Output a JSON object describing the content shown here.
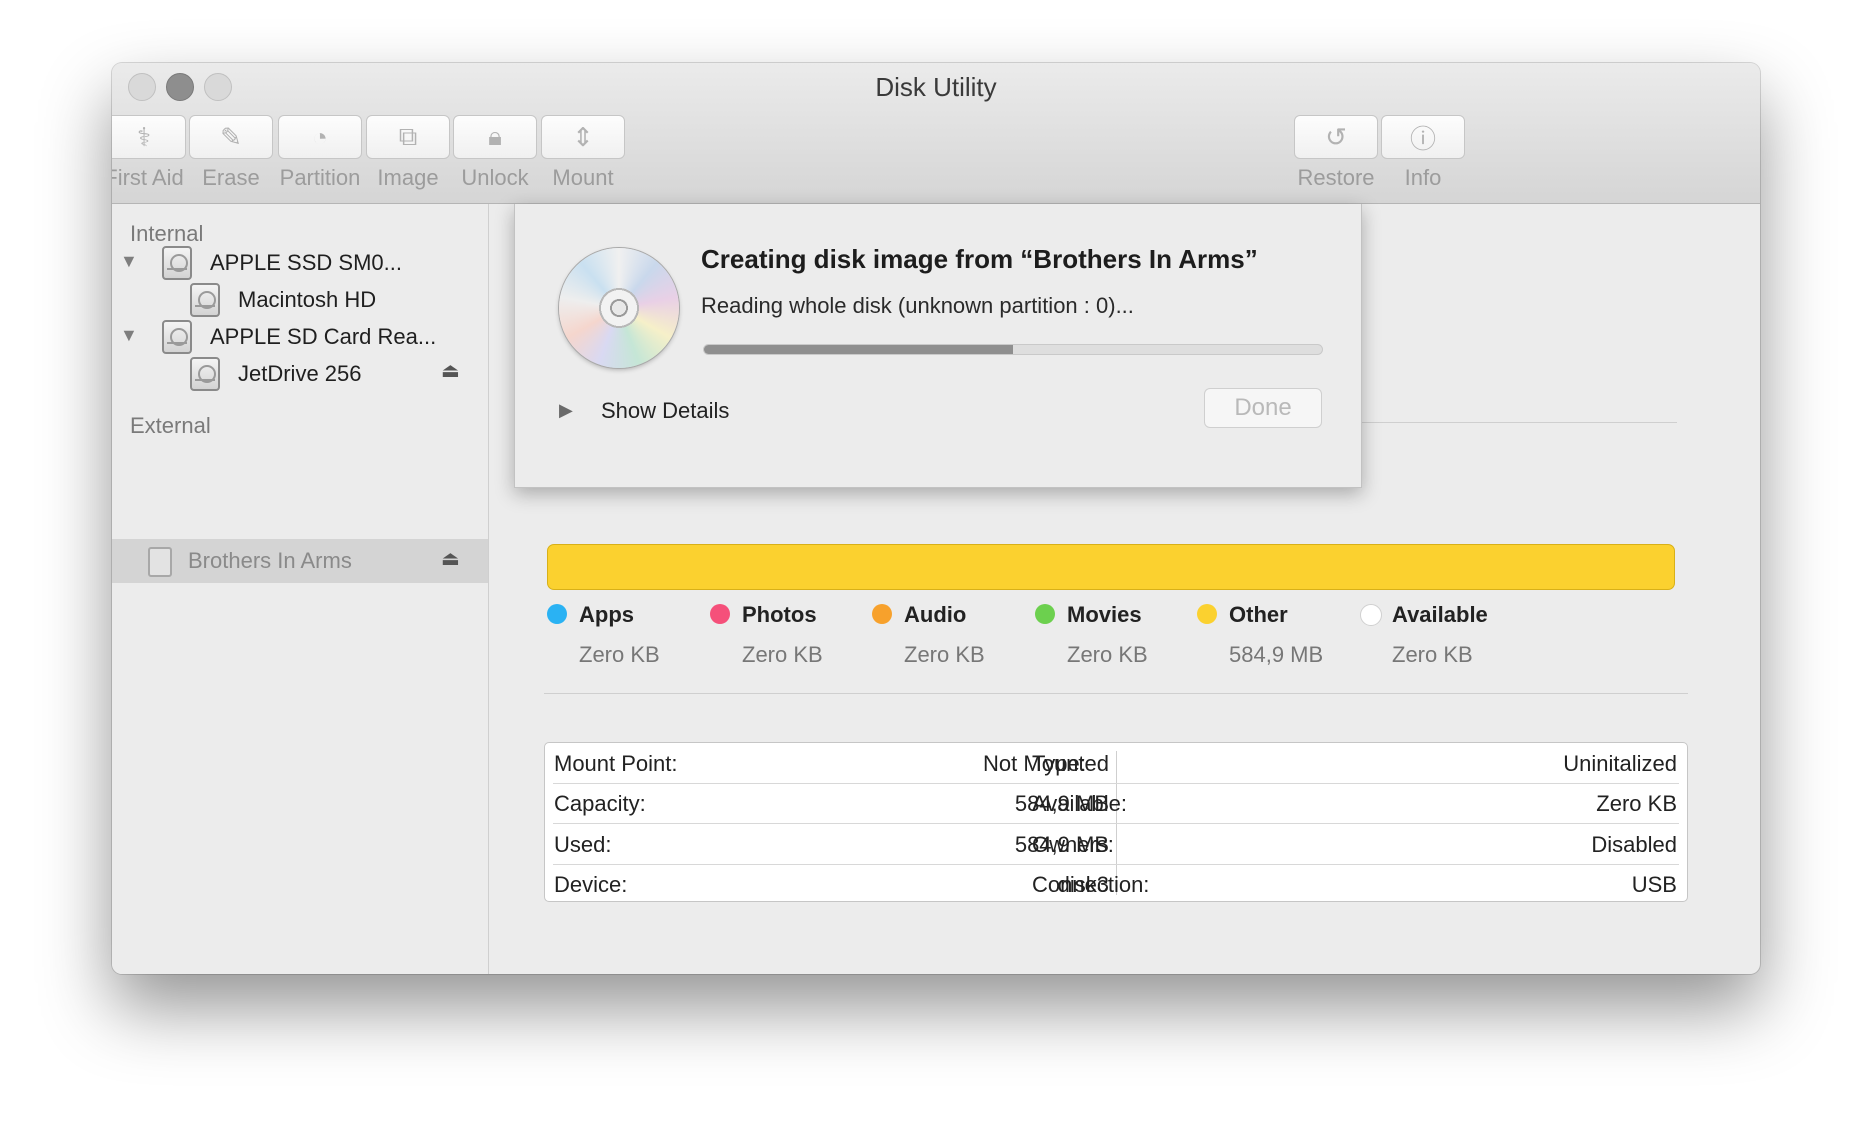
{
  "window": {
    "title": "Disk Utility"
  },
  "toolbar": {
    "first_aid": "First Aid",
    "erase": "Erase",
    "partition": "Partition",
    "image": "Image",
    "unlock": "Unlock",
    "mount": "Mount",
    "restore": "Restore",
    "info": "Info"
  },
  "icons": {
    "first_aid": "stethoscope-icon",
    "erase": "pencil-icon",
    "partition": "pie-icon",
    "image": "image-icon",
    "unlock": "lock-icon",
    "mount": "mount-icon",
    "restore": "restore-icon",
    "info": "info-icon"
  },
  "sidebar": {
    "internal_header": "Internal",
    "external_header": "External",
    "internal": [
      {
        "label": "APPLE SSD SM0..."
      },
      {
        "label": "Macintosh HD"
      },
      {
        "label": "APPLE SD Card Rea..."
      },
      {
        "label": "JetDrive 256"
      }
    ],
    "external": [
      {
        "label": "Brothers In Arms"
      }
    ]
  },
  "usage": {
    "bar_color": "#fbd12f",
    "legend": [
      {
        "name": "Apps",
        "size": "Zero KB",
        "color": "#2ab2f3"
      },
      {
        "name": "Photos",
        "size": "Zero KB",
        "color": "#f5507a"
      },
      {
        "name": "Audio",
        "size": "Zero KB",
        "color": "#f7a12c"
      },
      {
        "name": "Movies",
        "size": "Zero KB",
        "color": "#6cd04e"
      },
      {
        "name": "Other",
        "size": "584,9 MB",
        "color": "#fbd12f"
      },
      {
        "name": "Available",
        "size": "Zero KB",
        "color": "#ffffff"
      }
    ]
  },
  "info_table": {
    "left": [
      {
        "key": "Mount Point:",
        "value": "Not Mounted"
      },
      {
        "key": "Capacity:",
        "value": "584,9 MB"
      },
      {
        "key": "Used:",
        "value": "584,9 MB"
      },
      {
        "key": "Device:",
        "value": "disk3"
      }
    ],
    "right": [
      {
        "key": "Type:",
        "value": "Uninitalized"
      },
      {
        "key": "Available:",
        "value": "Zero KB"
      },
      {
        "key": "Owners:",
        "value": "Disabled"
      },
      {
        "key": "Connection:",
        "value": "USB"
      }
    ]
  },
  "sheet": {
    "title": "Creating disk image from “Brothers In Arms”",
    "status": "Reading whole disk (unknown partition : 0)...",
    "progress": 0.5,
    "show_details": "Show Details",
    "done": "Done"
  }
}
